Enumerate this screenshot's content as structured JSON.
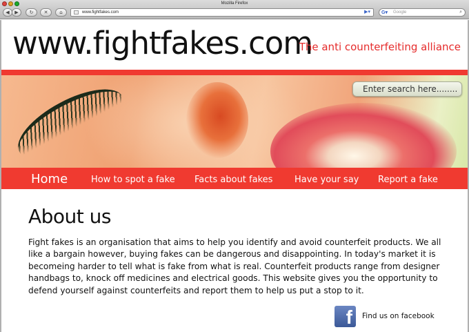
{
  "browser": {
    "window_title": "Mozilla Firefox",
    "url": "www.fightfakes.com",
    "search_placeholder": "Google",
    "search_engine_icon": "google-icon"
  },
  "site": {
    "logo": "www.fightfakes.com",
    "tagline": "The anti counterfeiting alliance",
    "accent_color": "#f03a30",
    "hero_search_placeholder": "Enter search here........"
  },
  "nav": {
    "items": [
      {
        "label": "Home"
      },
      {
        "label": "How to spot a fake"
      },
      {
        "label": "Facts about fakes"
      },
      {
        "label": "Have your say"
      },
      {
        "label": "Report a fake"
      }
    ]
  },
  "main": {
    "title": "About us",
    "body": "Fight fakes is an organisation that aims to help you identify and avoid counterfeit products. We all like a bargain however, buying fakes can be dangerous and disappointing. In today's market it is becomeing harder to tell what is fake from what is real. Counterfeit products range from designer handbags to, knock off medicines and electrical goods. This website gives you the opportunity to defend yourself against counterfeits and report them to help us put a stop to it.",
    "facebook_glyph": "f",
    "facebook_label": "Find us on facebook"
  }
}
